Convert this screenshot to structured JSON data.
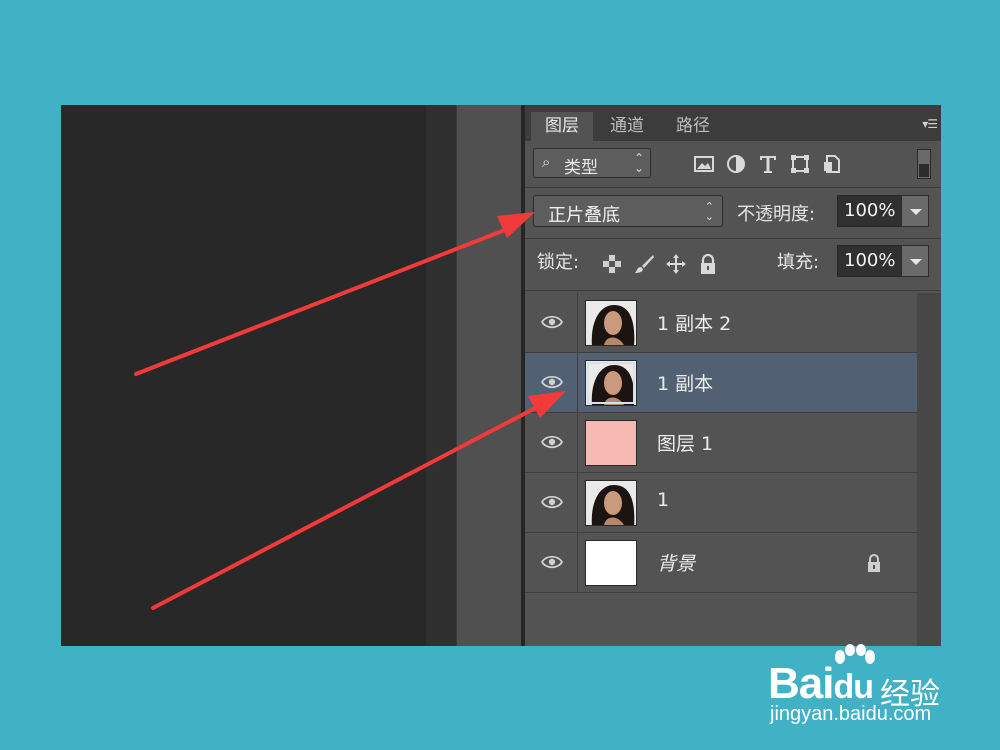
{
  "panel": {
    "tabs": [
      {
        "label": "图层",
        "active": true
      },
      {
        "label": "通道",
        "active": false
      },
      {
        "label": "路径",
        "active": false
      }
    ],
    "filter": {
      "icon": "search-icon",
      "label": "类型"
    },
    "filter_icons": [
      "image-icon",
      "adjustment-circle-icon",
      "type-T-icon",
      "shape-transform-icon",
      "smart-object-icon"
    ],
    "blend_mode": "正片叠底",
    "opacity_label": "不透明度:",
    "opacity_value": "100%",
    "lock_label": "锁定:",
    "lock_icons": [
      "lock-transparent-icon",
      "lock-brush-icon",
      "lock-move-icon",
      "lock-all-icon"
    ],
    "fill_label": "填充:",
    "fill_value": "100%"
  },
  "layers": [
    {
      "name": "1 副本 2",
      "thumb": "photo",
      "selected": false,
      "visible": true
    },
    {
      "name": "1 副本",
      "thumb": "photo",
      "selected": true,
      "visible": true
    },
    {
      "name": "图层 1",
      "thumb": "#f7b9b1",
      "selected": false,
      "visible": true
    },
    {
      "name": "1",
      "thumb": "photo",
      "selected": false,
      "visible": true
    },
    {
      "name": "背景",
      "thumb": "#ffffff",
      "selected": false,
      "visible": true,
      "locked": true
    }
  ],
  "watermark": {
    "brand": "Bai",
    "brand2": "du",
    "service": "经验",
    "url": "jingyan.baidu.com"
  },
  "colors": {
    "background": "#41b1c6",
    "panel": "#535353",
    "selected_layer": "#526074",
    "arrow": "#f23a3a"
  }
}
